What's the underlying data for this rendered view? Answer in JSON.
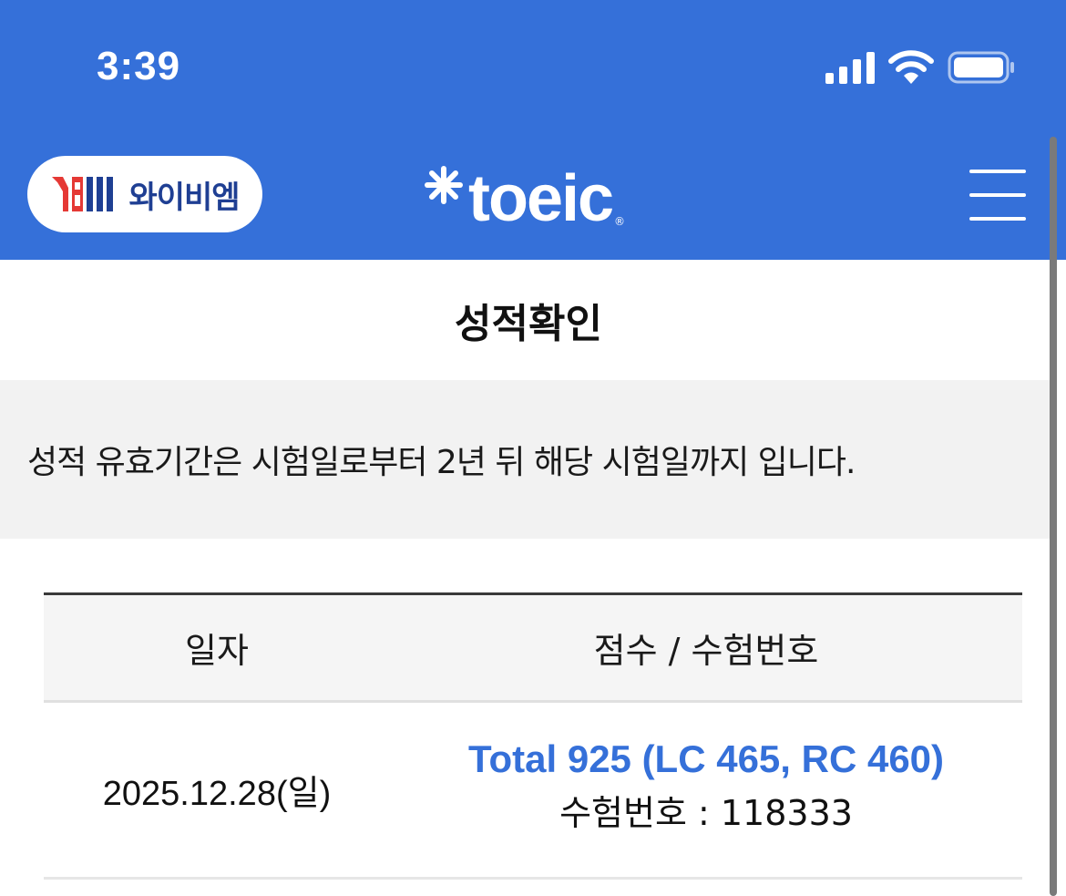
{
  "status_bar": {
    "time": "3:39",
    "icons": [
      "cellular-signal-icon",
      "wifi-icon",
      "battery-icon"
    ]
  },
  "header": {
    "ybm_logo_text": "와이비엠",
    "toeic_logo_text": "toeic",
    "menu_icon": "hamburger-menu-icon",
    "colors": {
      "brand_blue": "#3570d9",
      "ybm_red": "#e53935",
      "ybm_navy": "#1f3f93"
    }
  },
  "page": {
    "title": "성적확인",
    "notice": "성적 유효기간은 시험일로부터 2년 뒤 해당 시험일까지 입니다."
  },
  "table": {
    "headers": [
      "일자",
      "점수 / 수험번호"
    ],
    "rows": [
      {
        "date": "2025.12.28(일)",
        "score": "Total 925 (LC 465, RC 460)",
        "exam_number": "수험번호 : 118333"
      }
    ]
  }
}
